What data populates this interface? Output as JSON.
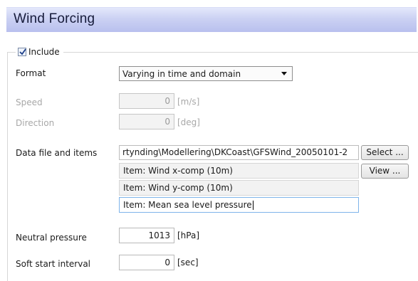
{
  "panel": {
    "title": "Wind Forcing"
  },
  "include": {
    "label": "Include",
    "checked": true
  },
  "format": {
    "label": "Format",
    "value": "Varying in time and domain"
  },
  "speed": {
    "label": "Speed",
    "value": "0",
    "unit": "[m/s]"
  },
  "direction": {
    "label": "Direction",
    "value": "0",
    "unit": "[deg]"
  },
  "data_file": {
    "label": "Data file and items",
    "path": "rtynding\\Modellering\\DKCoast\\GFSWind_20050101-2",
    "select_label": "Select ...",
    "view_label": "View ...",
    "items": [
      "Item:  Wind x-comp (10m)",
      "Item:  Wind y-comp (10m)",
      "Item:  Mean sea level pressure"
    ]
  },
  "neutral_pressure": {
    "label": "Neutral pressure",
    "value": "1013",
    "unit": "[hPa]"
  },
  "soft_start": {
    "label": "Soft start interval",
    "value": "0",
    "unit": "[sec]"
  }
}
